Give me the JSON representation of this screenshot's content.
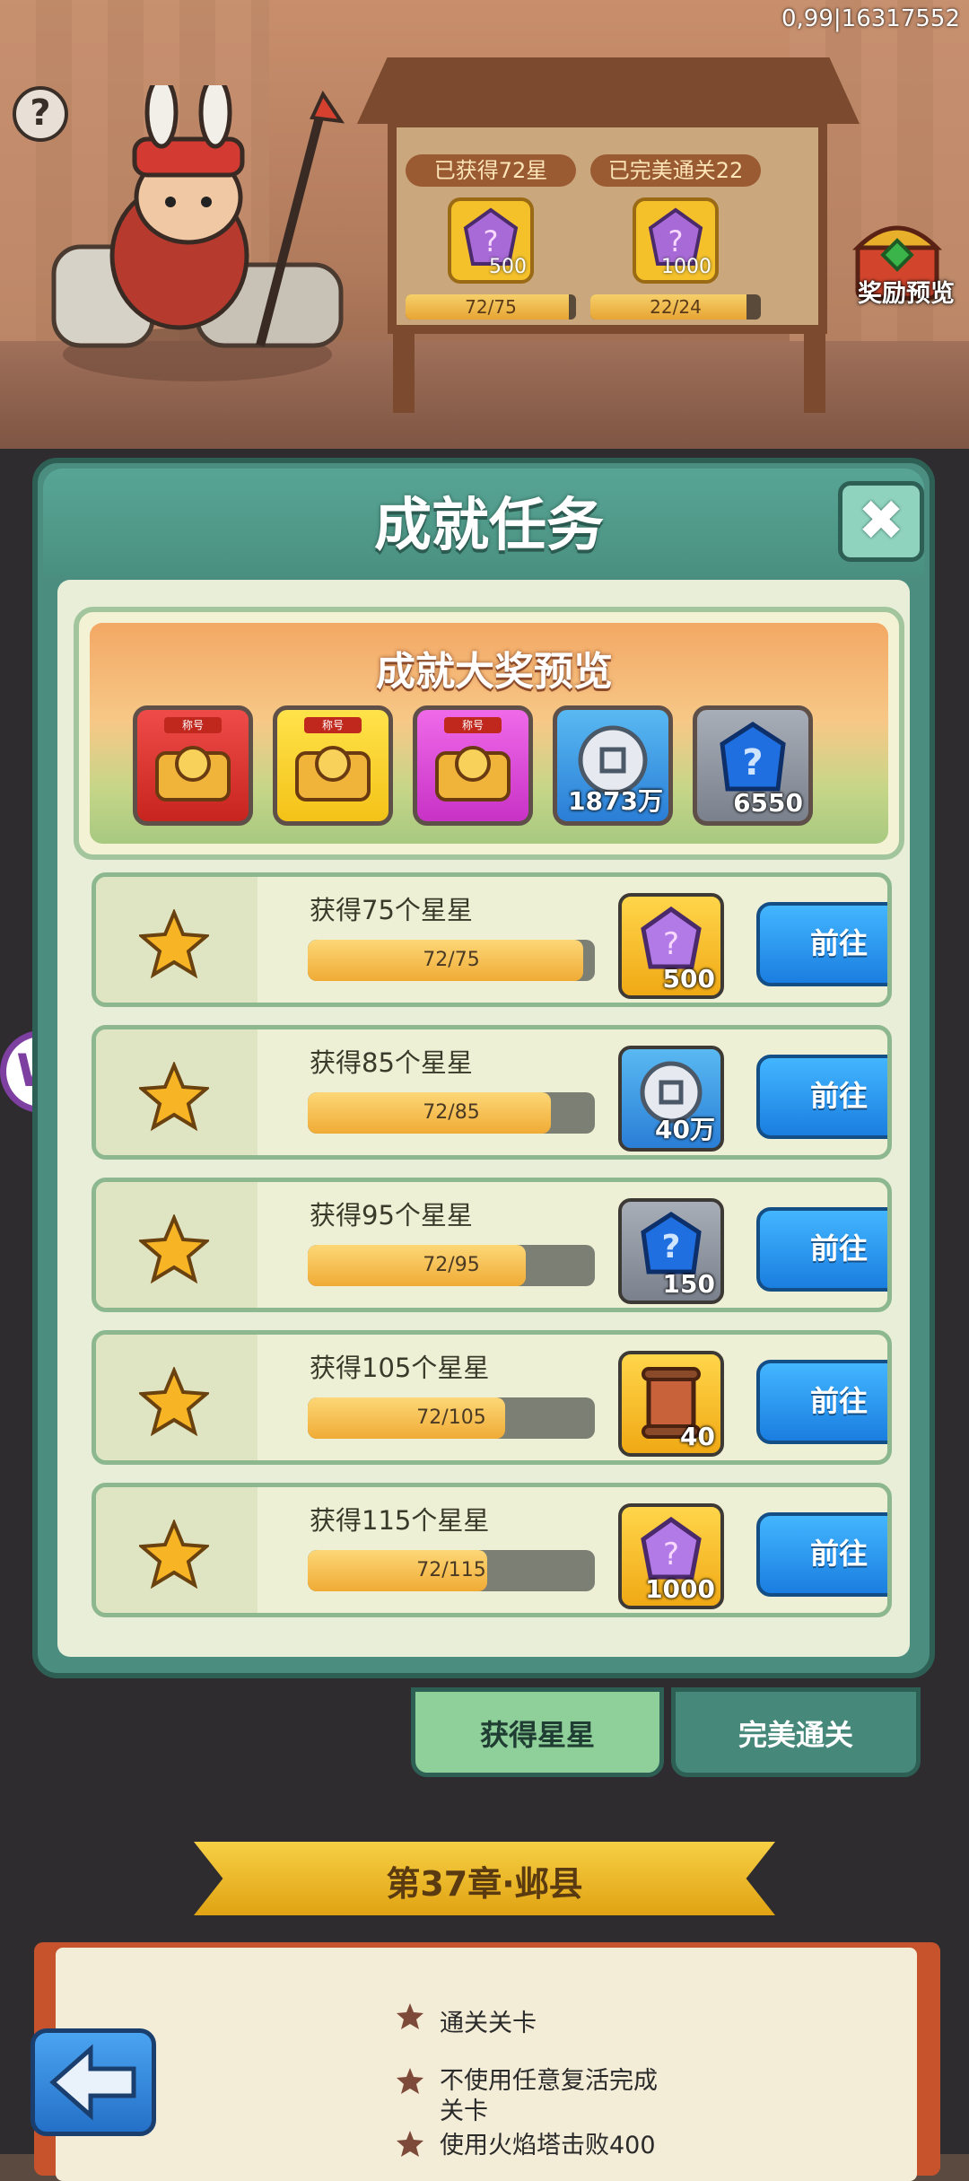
{
  "status_bar": {
    "text": "0,99|16317552"
  },
  "scene": {
    "help_label": "?",
    "board": [
      {
        "title": "已获得72星",
        "reward_value": "500",
        "progress_text": "72/75",
        "progress": 0.96,
        "gem_color": "#a86ad6"
      },
      {
        "title": "已完美通关22",
        "reward_value": "1000",
        "progress_text": "22/24",
        "progress": 0.917,
        "gem_color": "#a86ad6"
      }
    ],
    "reward_preview_label": "奖励预览"
  },
  "modal": {
    "title": "成就任务",
    "close_label": "✖",
    "grand_title": "成就大奖预览",
    "grand_items": [
      {
        "name": "red-chest",
        "tag": "称号",
        "value": ""
      },
      {
        "name": "yellow-chest",
        "tag": "称号",
        "value": ""
      },
      {
        "name": "purple-chest",
        "tag": "称号",
        "value": ""
      },
      {
        "name": "silver-coin",
        "tag": "",
        "value": "1873万"
      },
      {
        "name": "blue-crystal",
        "tag": "",
        "value": "6550"
      }
    ],
    "tasks": [
      {
        "title": "获得75个星星",
        "progress_text": "72/75",
        "progress": 0.96,
        "reward": "500",
        "reward_icon": "purple-gem-icon",
        "go": "前往"
      },
      {
        "title": "获得85个星星",
        "progress_text": "72/85",
        "progress": 0.847,
        "reward": "40万",
        "reward_icon": "silver-coin-icon",
        "go": "前往"
      },
      {
        "title": "获得95个星星",
        "progress_text": "72/95",
        "progress": 0.758,
        "reward": "150",
        "reward_icon": "blue-crystal-icon",
        "go": "前往"
      },
      {
        "title": "获得105个星星",
        "progress_text": "72/105",
        "progress": 0.686,
        "reward": "40",
        "reward_icon": "scroll-icon",
        "go": "前往"
      },
      {
        "title": "获得115个星星",
        "progress_text": "72/115",
        "progress": 0.626,
        "reward": "1000",
        "reward_icon": "purple-gem-icon",
        "go": "前往"
      }
    ]
  },
  "tabs": {
    "stars": "获得星星",
    "perfect": "完美通关"
  },
  "chapter": {
    "title": "第37章·邺县",
    "requirements": [
      "通关关卡",
      "不使用任意复活完成",
      "关卡",
      "使用火焰塔击败400"
    ]
  },
  "floating_logo": "W"
}
